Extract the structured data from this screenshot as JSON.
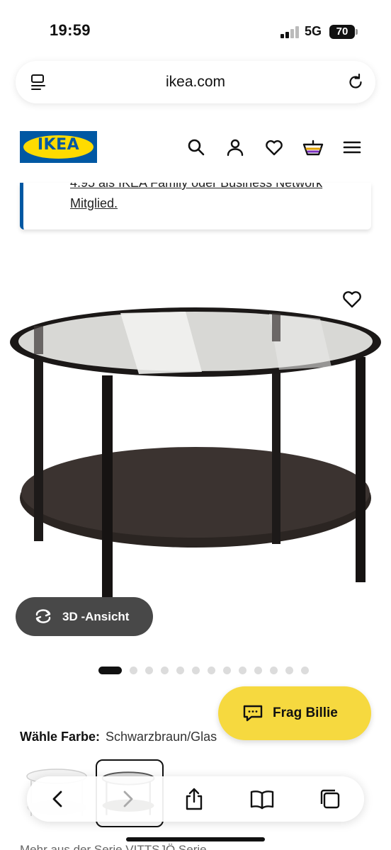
{
  "status_bar": {
    "time": "19:59",
    "network": "5G",
    "battery": "70"
  },
  "browser": {
    "url": "ikea.com"
  },
  "header": {
    "logo_text": "IKEA"
  },
  "promo": {
    "text": "4.95 als IKEA Family oder Business Network Mitglied."
  },
  "product": {
    "view3d_label": "3D -Ansicht",
    "image_count": 13,
    "active_image": 1
  },
  "colour": {
    "label": "Wähle Farbe:",
    "value": "Schwarzbraun/Glas"
  },
  "assistant": {
    "label": "Frag Billie"
  },
  "series": {
    "text": "Mehr aus der Serie VITTSJÖ Serie"
  },
  "colors": {
    "ikea_blue": "#0058a3",
    "ikea_yellow": "#ffdb00",
    "billie_yellow": "#f6d93f"
  }
}
